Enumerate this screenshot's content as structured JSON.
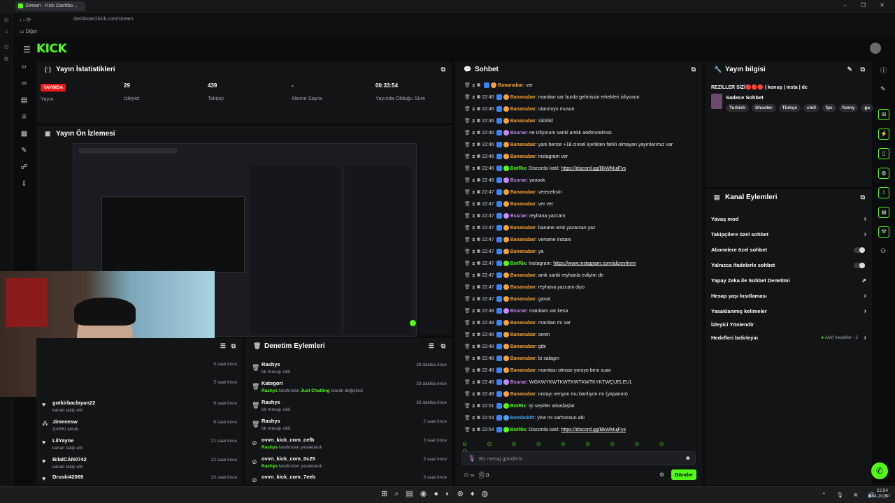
{
  "browser": {
    "tab_title": "Stream - Kick Dashbo…",
    "url": "dashboard.kick.com/stream",
    "bookmarks_label": "Diğer",
    "window_controls": "– ❐ ✕"
  },
  "app": {
    "logo": "KICK",
    "stats_panel": {
      "title": "Yayın İstatistikleri",
      "live_badge": "YAYINDA",
      "items": [
        {
          "value": "",
          "label": "Yayın"
        },
        {
          "value": "29",
          "label": "İzleyici"
        },
        {
          "value": "439",
          "label": "Takipçi"
        },
        {
          "value": "-",
          "label": "Abone Sayısı"
        },
        {
          "value": "00:33:54",
          "label": "Yayında Olduğu Süre"
        }
      ]
    },
    "preview_panel": {
      "title": "Yayın Ön İzlemesi"
    },
    "activity_feed": [
      {
        "icon": "heart-icon",
        "name": "gotkirbaclayan22",
        "sub": "kanalı takip etti",
        "time": "6 saat önce"
      },
      {
        "icon": "users-icon",
        "name": "Jimenesw",
        "sub": "ŞARKI alındı",
        "time": "6 saat önce"
      },
      {
        "icon": "heart-icon",
        "name": "LilYayne",
        "sub": "kanalı takip etti",
        "time": "21 saat önce"
      },
      {
        "icon": "heart-icon",
        "name": "BilalCAN0742",
        "sub": "kanalı takip etti",
        "time": "22 saat önce"
      },
      {
        "icon": "heart-icon",
        "name": "Druski42069",
        "sub": "kanalı takip etti",
        "time": "23 saat önce"
      }
    ],
    "activity_hidden_times": [
      "5 saat önce",
      "5 saat önce"
    ],
    "moderation": {
      "title": "Denetim Eylemleri",
      "rows": [
        {
          "name": "Rashys",
          "sub": "bir mesajı sildi",
          "time": "28 dakika önce",
          "icon": "trash-icon"
        },
        {
          "name": "Kategori",
          "sub_pre": "Rashys",
          "sub_mid": " tarafından ",
          "sub_hl": "Just Chatting",
          "sub_post": " olarak değiştirdi",
          "time": "33 dakika önce",
          "icon": "trash-icon"
        },
        {
          "name": "Rashys",
          "sub": "bir mesajı sildi",
          "time": "33 dakika önce",
          "icon": "trash-icon"
        },
        {
          "name": "Rashys",
          "sub": "bir mesajı sildi",
          "time": "2 saat önce",
          "icon": "trash-icon"
        },
        {
          "name": "ovvn_kick_com_cefb",
          "sub_pre": "Rashys",
          "sub_mid": " tarafından yasaklandı",
          "time": "3 saat önce",
          "icon": "ban-icon"
        },
        {
          "name": "ovvn_kick_com_0c25",
          "sub_pre": "Rashys",
          "sub_mid": " tarafından yasaklandı",
          "time": "3 saat önce",
          "icon": "ban-icon"
        },
        {
          "name": "ovvn_kick_com_7eeb",
          "sub": "",
          "time": "3 saat önce",
          "icon": "ban-icon"
        }
      ]
    },
    "chat": {
      "title": "Sohbet",
      "messages": [
        {
          "time": "",
          "user": "Bananabar",
          "color": "#f2a33a",
          "text": "ver"
        },
        {
          "time": "22:46",
          "user": "Bananabar",
          "color": "#f2a33a",
          "text": "manitan var burda gelmissin erkekleri izliyosun"
        },
        {
          "time": "22:46",
          "user": "Bananabar",
          "color": "#f2a33a",
          "text": "utanmıyo musun"
        },
        {
          "time": "22:46",
          "user": "Bananabar",
          "color": "#f2a33a",
          "text": "siktirikl"
        },
        {
          "time": "22:46",
          "user": "Bssrae",
          "color": "#c58bf2",
          "text": "ne izliyorum sanki amkk aödmsödmsk"
        },
        {
          "time": "22:46",
          "user": "Bananabar",
          "color": "#f2a33a",
          "text": "yani bence +18 cinsel içerikten farklı olmayan yayınlarımız var"
        },
        {
          "time": "22:46",
          "user": "Bananabar",
          "color": "#f2a33a",
          "text": "instagram ver"
        },
        {
          "time": "22:46",
          "user": "BotRix",
          "color": "#53fc18",
          "text": "Discorda katıl: ",
          "link": "https://discord.gg/BkWMujFys"
        },
        {
          "time": "22:46",
          "user": "Bssrae",
          "color": "#c58bf2",
          "text": "yooook"
        },
        {
          "time": "22:47",
          "user": "Bananabar",
          "color": "#f2a33a",
          "text": "vereceksin"
        },
        {
          "time": "22:47",
          "user": "Bananabar",
          "color": "#f2a33a",
          "text": "ver ver"
        },
        {
          "time": "22:47",
          "user": "Bssrae",
          "color": "#c58bf2",
          "text": "reyhana yazcam"
        },
        {
          "time": "22:47",
          "user": "Bananabar",
          "color": "#f2a33a",
          "text": "banane amk yazarsan yaz"
        },
        {
          "time": "22:47",
          "user": "Bananabar",
          "color": "#f2a33a",
          "text": "versene instanı"
        },
        {
          "time": "22:47",
          "user": "Bananabar",
          "color": "#f2a33a",
          "text": "ya"
        },
        {
          "time": "22:47",
          "user": "BotRix",
          "color": "#53fc18",
          "text": "Instagram: ",
          "link": "https://www.instagram.com/alizeytinnn"
        },
        {
          "time": "22:47",
          "user": "Bananabar",
          "color": "#f2a33a",
          "text": "amk sanki reyhanla evliyim de"
        },
        {
          "time": "22:47",
          "user": "Bananabar",
          "color": "#f2a33a",
          "text": "reyhana yazcam diyo"
        },
        {
          "time": "22:47",
          "user": "Bananabar",
          "color": "#f2a33a",
          "text": "gavat"
        },
        {
          "time": "22:48",
          "user": "Bssrae",
          "color": "#c58bf2",
          "text": "manitam var kesa"
        },
        {
          "time": "22:48",
          "user": "Bananabar",
          "color": "#f2a33a",
          "text": "manitan mı var"
        },
        {
          "time": "22:48",
          "user": "Bananabar",
          "color": "#f2a33a",
          "text": "senin"
        },
        {
          "time": "22:48",
          "user": "Bananabar",
          "color": "#f2a33a",
          "text": "gibi"
        },
        {
          "time": "22:48",
          "user": "Bananabar",
          "color": "#f2a33a",
          "text": "bi salagın"
        },
        {
          "time": "22:48",
          "user": "Bananabar",
          "color": "#f2a33a",
          "text": "manitası olması yoruyo beni suan"
        },
        {
          "time": "22:48",
          "user": "Bssrae",
          "color": "#c58bf2",
          "text": "WGKWYKWTKWTKWTKWTKYKTWÇUELEUL"
        },
        {
          "time": "22:48",
          "user": "Bananabar",
          "color": "#f2a33a",
          "text": "instayı veriyon mu banlıyım mı (yapanım)"
        },
        {
          "time": "22:51",
          "user": "BotRix",
          "color": "#53fc18",
          "text": "iyi seyirler arkadaşlar"
        },
        {
          "time": "22:54",
          "user": "BombokItt",
          "color": "#4aa3f2",
          "text": "yine mi sarhossun abi"
        },
        {
          "time": "22:54",
          "user": "BotRix",
          "color": "#53fc18",
          "text": "Discorda katıl: ",
          "link": "https://discord.gg/BkWMujFys"
        }
      ],
      "input_placeholder": "Bir mesaj gönderin",
      "send_label": "Gönder",
      "count": "0"
    },
    "info_panel": {
      "title": "Yayın bilgisi",
      "stream_title": "REZİLLER SİZİ🔴🔴🔴 | konuş | insta | dc",
      "category": "Sadece Sohbet",
      "tags": [
        "Turkish",
        "Shooter",
        "Türkçe",
        "chill",
        "fps",
        "funny",
        "ga"
      ]
    },
    "actions_panel": {
      "title": "Kanal Eylemleri",
      "rows": [
        {
          "label": "Yavaş mod",
          "control": "chevron"
        },
        {
          "label": "Takipçilere özel sohbet",
          "control": "chevron"
        },
        {
          "label": "Abonelere özel sohbet",
          "control": "toggle"
        },
        {
          "label": "Yalnızca ifadelerle sohbet",
          "control": "toggle"
        },
        {
          "label": "Yapay Zeka ile Sohbet Denetimi",
          "control": "external"
        },
        {
          "label": "Hesap yaşı kısıtlaması",
          "control": "chevron"
        },
        {
          "label": "Yasaklanmış kelimeler",
          "control": "chevron"
        },
        {
          "label": "İzleyici Yönlendir",
          "control": "none"
        },
        {
          "label": "Hedefleri belirleyin",
          "control": "goal",
          "note": "Aktif hedefler - 2"
        }
      ]
    }
  },
  "taskbar": {
    "time": "22:54",
    "date": "5.04.2026"
  },
  "colors": {
    "brand": "#53fc18",
    "live": "#e91916",
    "panel": "#131416",
    "bg": "#0b0c0d"
  }
}
